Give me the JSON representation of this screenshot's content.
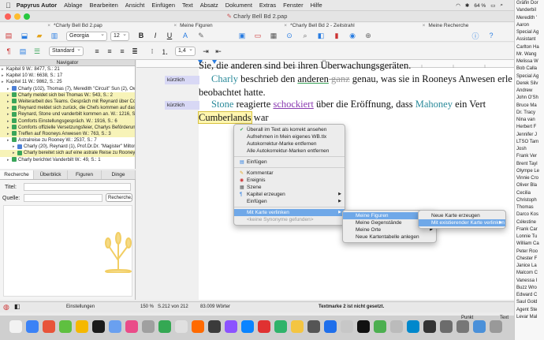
{
  "menubar": {
    "app_name": "Papyrus Autor",
    "items": [
      "Ablage",
      "Bearbeiten",
      "Ansicht",
      "Einfügen",
      "Text",
      "Absatz",
      "Dokument",
      "Extras",
      "Fenster",
      "Hilfe"
    ],
    "battery": "64 %"
  },
  "window": {
    "title": "Charly Bell Bd 2.pap"
  },
  "doc_tabs": [
    "*Charly Bell Bd 2.pap",
    "Meine Figuren",
    "*Charly Bell Bd 2 - Zeitstrahl",
    "Meine Recherche"
  ],
  "toolbar": {
    "font": "Georgia",
    "size": "12",
    "style": "Standard",
    "line_spacing": "1,4"
  },
  "navigator": {
    "title": "Navigator",
    "rows": [
      {
        "label": "Kapitel 9  W.: 8477, S.: 21",
        "indent": 0,
        "color": "",
        "bg": ""
      },
      {
        "label": "Kapitel 10  W.: 6638, S.: 17",
        "indent": 0,
        "color": "",
        "bg": ""
      },
      {
        "label": "Kapitel 11  W.: 9862, S.: 25",
        "indent": 0,
        "color": "",
        "bg": ""
      },
      {
        "label": "Charly (102), Thomas (7), Meredith \"Circuit\" Sun (2), Owen...",
        "indent": 1,
        "color": "#4c7fd6",
        "bg": ""
      },
      {
        "label": "Charly meldet sich bei Thomas  W.: 543, S.: 2",
        "indent": 1,
        "color": "#3aa55a",
        "bg": "yellow"
      },
      {
        "label": "Weiterarbeit des Teams. Gespräch mit Reynard über Co...",
        "indent": 1,
        "color": "#3aa55a",
        "bg": "yellow"
      },
      {
        "label": "Reynard meldet sich zurück, die Chefs kommen auf das...",
        "indent": 1,
        "color": "#3aa55a",
        "bg": "yellow"
      },
      {
        "label": "Reynard, Stone und vanderbilt kommen an.  W.: 1216, S.: 4",
        "indent": 1,
        "color": "#3aa55a",
        "bg": "yellow"
      },
      {
        "label": "Comforts Einstellungsgespräch.  W.: 1916, S.: 6",
        "indent": 1,
        "color": "#3aa55a",
        "bg": "yellow"
      },
      {
        "label": "Comforts offizielle Versetzungsfeier, Charlys Beförderun...",
        "indent": 1,
        "color": "#3aa55a",
        "bg": "yellow"
      },
      {
        "label": "Treffen auf Rooneys Anwesen  W.: 763, S.: 3",
        "indent": 1,
        "color": "#3aa55a",
        "bg": "yellow"
      },
      {
        "label": "Astralreise zu Rooney  W.: 2537, S.: 7",
        "indent": 1,
        "color": "#3aa55a",
        "bg": ""
      },
      {
        "label": "Charly (20), Reynard (1), Prof.Dr.Dr. \"Magister\" Milton V...",
        "indent": 2,
        "color": "#4c7fd6",
        "bg": ""
      },
      {
        "label": "Charly bereitet sich auf eine astrale Reise zu Rooney vor.",
        "indent": 2,
        "color": "#3aa55a",
        "bg": "yellow"
      },
      {
        "label": "Charly berichtet Vanderbilt  W.: 49, S.: 1",
        "indent": 1,
        "color": "#3aa55a",
        "bg": ""
      }
    ]
  },
  "panel": {
    "tabs": [
      "Recherche",
      "Überblick",
      "Figuren",
      "Dinge"
    ],
    "title_label": "Titel:",
    "source_label": "Quelle:",
    "source_button": "Recherche..."
  },
  "editor": {
    "line0": "Sie, die anderen sind bei ihren Überwachungsgeräten.",
    "note1": "kürzlich",
    "line1": [
      "Charly",
      " beschrieb den ",
      "anderen",
      " ganz",
      " genau, was sie in Rooneys Anwesen erle"
    ],
    "line2": "beobachtet hatte.",
    "note2": "kürzlich",
    "line3": [
      "Stone",
      " reagierte ",
      "schockiert",
      " über die Eröffnung, dass ",
      "Mahoney",
      " ein Vert"
    ],
    "line4": [
      "Cumberlands",
      " war"
    ]
  },
  "context_menu": {
    "main": [
      {
        "label": "Überall im Text als korrekt ansehen",
        "icon": "check-icon"
      },
      {
        "label": "Aufnehmen in  Mein eigenes WB.tlx"
      },
      {
        "label": "Autokorrektur-Marke entfernen"
      },
      {
        "label": "Alle Autokorrektur-Marken entfernen"
      },
      {
        "sep": true
      },
      {
        "label": "Einfügen",
        "icon": "paste-icon"
      },
      {
        "sep": true
      },
      {
        "label": "Kommentar",
        "icon": "comment-icon"
      },
      {
        "label": "Ereignis",
        "icon": "event-icon"
      },
      {
        "label": "Szene",
        "icon": "scene-icon"
      },
      {
        "label": "Kapitel erzeugen",
        "icon": "chapter-icon",
        "arrow": true
      },
      {
        "label": "Einfügen",
        "arrow": true
      },
      {
        "sep": true
      },
      {
        "label": "Mit Karte verlinken",
        "arrow": true,
        "hl": true
      },
      {
        "label": "<keine Synonyme gefunden>",
        "dis": true
      }
    ],
    "sub1": [
      {
        "label": "Meine Figuren",
        "arrow": true,
        "hl": true
      },
      {
        "label": "Meine Gegenstände",
        "arrow": true
      },
      {
        "label": "Meine Orte",
        "arrow": true
      },
      {
        "label": "Neue Kartentabelle anlegen"
      }
    ],
    "sub2": [
      {
        "label": "Neue Karte erzeugen"
      },
      {
        "label": "Mit existierender Karte verlinken",
        "arrow": true,
        "hl": true
      }
    ]
  },
  "status": {
    "settings": "Einstellungen",
    "zoom": "150 %",
    "page": "S.212 von 212",
    "words": "83.009 Wörter",
    "message": "Textmarke 2 ist nicht gesetzt."
  },
  "dock_labels": [
    "Punkt",
    "Text"
  ],
  "names": [
    "Gräfin Dor",
    "Vanderbil",
    "Meredith '",
    "Aaron",
    "Special Ag",
    "Assistant",
    "Carlton Ha",
    "Mr. Wang",
    "Melissa W",
    "Bob Calla",
    "Special Ag",
    "Derek Silv",
    "Andrew",
    "John O'Sh",
    "Bruce Ma",
    "Dr. Tracy",
    "Nina van",
    "Herbert F",
    "Jennifer J",
    "LTSO Tam",
    "Josh",
    "Frank Ver",
    "Brent Tayl",
    "Olympe Le",
    "Vinnie Cro",
    "Oliver Bla",
    "Cecilia",
    "Christoph",
    "Thomas",
    "Darco Kos",
    "Célestine",
    "Frank Car",
    "Lonnie Tu",
    "William Ca",
    "Peter Roo",
    "Chester F",
    "Janice La",
    "Malcom C",
    "Vanessa I",
    "Buzz Wro",
    "Edward C",
    "Saul Gold",
    "Agent Ste",
    "Levar Mal"
  ]
}
